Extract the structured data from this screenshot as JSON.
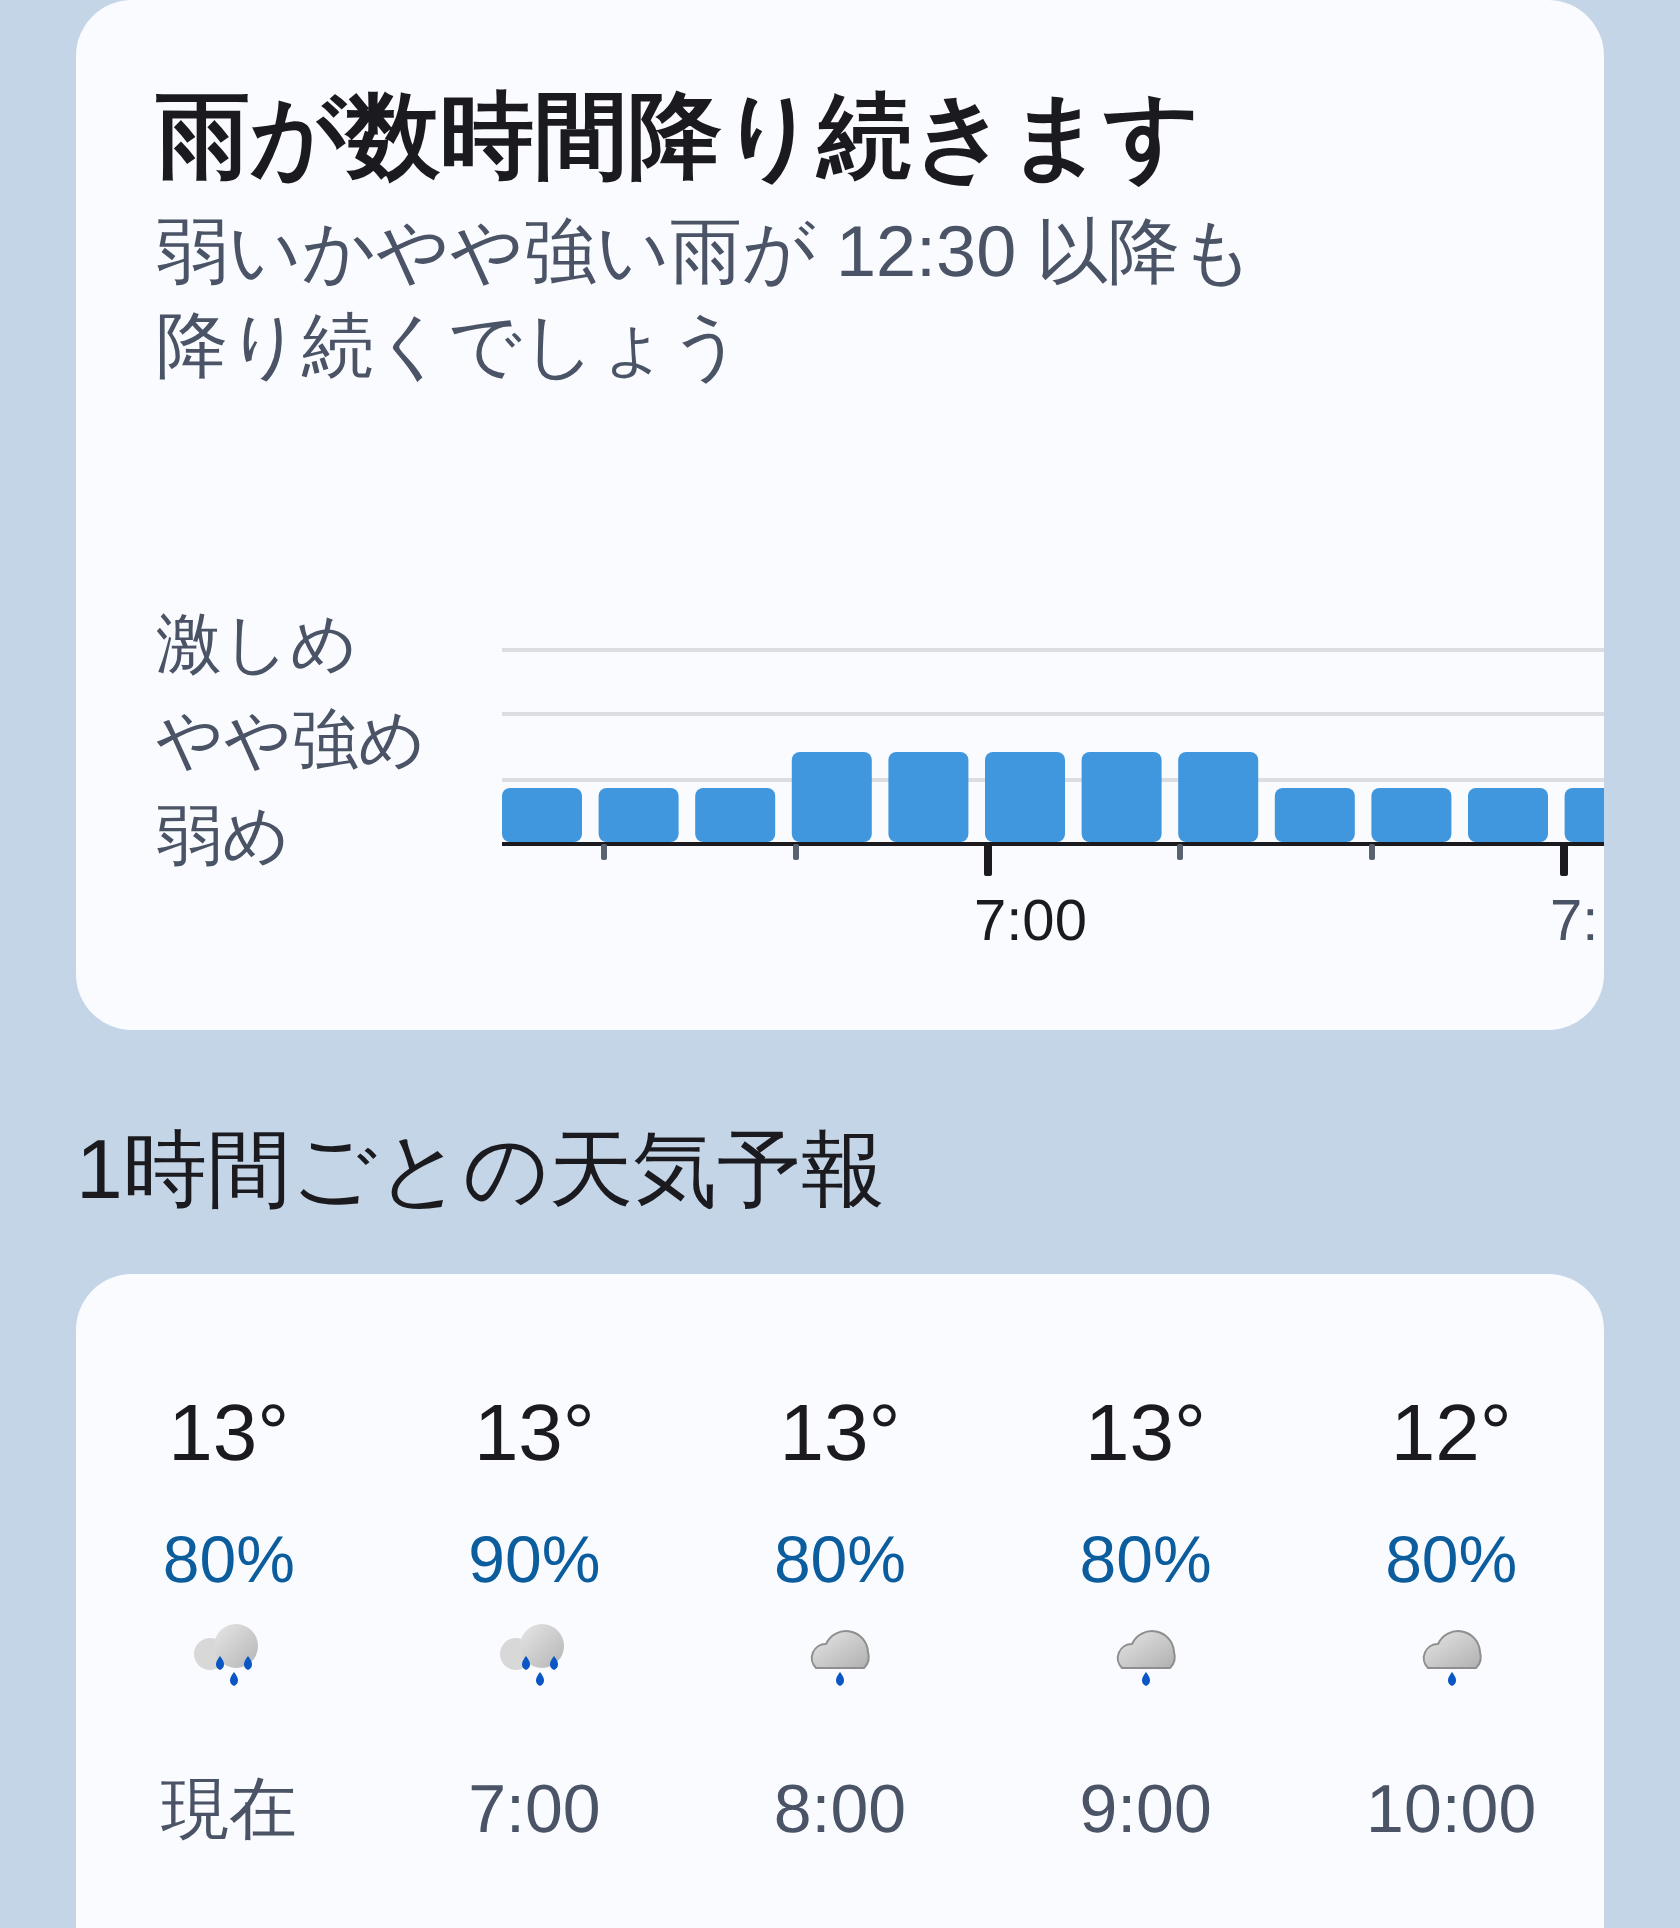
{
  "rain_card": {
    "title": "雨が数時間降り続きます",
    "subtitle": "弱いかやや強い雨が 12:30 以降も降り続くでしょう",
    "intensity_labels": [
      "激しめ",
      "やや強め",
      "弱め"
    ],
    "bars": [
      {
        "kind": "light"
      },
      {
        "kind": "light"
      },
      {
        "kind": "light"
      },
      {
        "kind": "moderate"
      },
      {
        "kind": "moderate"
      },
      {
        "kind": "moderate"
      },
      {
        "kind": "moderate"
      },
      {
        "kind": "moderate"
      },
      {
        "kind": "light"
      },
      {
        "kind": "light"
      },
      {
        "kind": "light"
      },
      {
        "kind": "light"
      }
    ],
    "time_labels": [
      "7:00",
      "7:"
    ]
  },
  "hourly_title": "1時間ごとの天気予報",
  "hourly": [
    {
      "temp": "13°",
      "chance": "80%",
      "kind": "heavy",
      "time": "現在"
    },
    {
      "temp": "13°",
      "chance": "90%",
      "kind": "heavy",
      "time": "7:00"
    },
    {
      "temp": "13°",
      "chance": "80%",
      "kind": "light",
      "time": "8:00"
    },
    {
      "temp": "13°",
      "chance": "80%",
      "kind": "light",
      "time": "9:00"
    },
    {
      "temp": "12°",
      "chance": "80%",
      "kind": "light",
      "time": "10:00"
    }
  ]
}
